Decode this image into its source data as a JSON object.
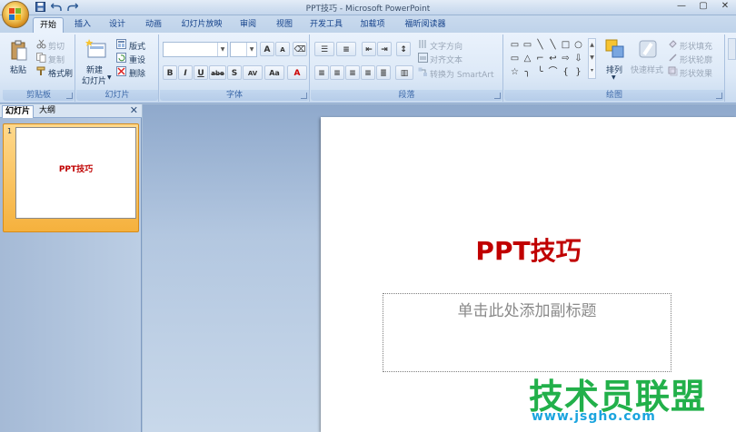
{
  "window": {
    "title": "PPT技巧 - Microsoft PowerPoint",
    "controls": [
      "—",
      "▢",
      "✕"
    ]
  },
  "quick_access": {
    "icons": [
      "save-icon",
      "undo-icon",
      "redo-icon"
    ]
  },
  "tabs": [
    {
      "label": "开始",
      "active": true
    },
    {
      "label": "插入"
    },
    {
      "label": "设计"
    },
    {
      "label": "动画"
    },
    {
      "label": "幻灯片放映"
    },
    {
      "label": "审阅"
    },
    {
      "label": "视图"
    },
    {
      "label": "开发工具"
    },
    {
      "label": "加载项"
    },
    {
      "label": "福昕阅读器"
    }
  ],
  "ribbon": {
    "clipboard": {
      "group_label": "剪贴板",
      "paste": "粘贴",
      "cut": "剪切",
      "copy": "复制",
      "format_painter": "格式刷"
    },
    "slides": {
      "group_label": "幻灯片",
      "new_slide_line1": "新建",
      "new_slide_line2": "幻灯片",
      "layout": "版式",
      "reset": "重设",
      "delete": "删除"
    },
    "font": {
      "group_label": "字体",
      "buttons": [
        "B",
        "I",
        "U",
        "abe",
        "S",
        "AV",
        "Aa",
        "A"
      ]
    },
    "paragraph": {
      "group_label": "段落",
      "text_direction": "文字方向",
      "align_text": "对齐文本",
      "smartart": "转换为 SmartArt"
    },
    "drawing": {
      "group_label": "绘图",
      "arrange": "排列",
      "quick_styles": "快速样式",
      "shape_fill": "形状填充",
      "shape_outline": "形状轮廓",
      "shape_effects": "形状效果",
      "shapes": [
        "▭",
        "▭",
        "╲",
        "╲",
        "□",
        "○",
        "▭",
        "△",
        "⌐",
        "↩",
        "⇨",
        "⇩",
        "☆",
        "╮",
        "╰",
        "⌒",
        "{",
        "}"
      ]
    }
  },
  "left_pane": {
    "tab_slides": "幻灯片",
    "tab_outline": "大纲",
    "close": "✕",
    "thumbnails": [
      {
        "number": "1",
        "title": "PPT技巧"
      }
    ]
  },
  "slide": {
    "title": "PPT技巧",
    "subtitle_placeholder": "单击此处添加副标题"
  },
  "watermark": {
    "text": "技术员联盟",
    "url": "www.jsgho.com"
  }
}
